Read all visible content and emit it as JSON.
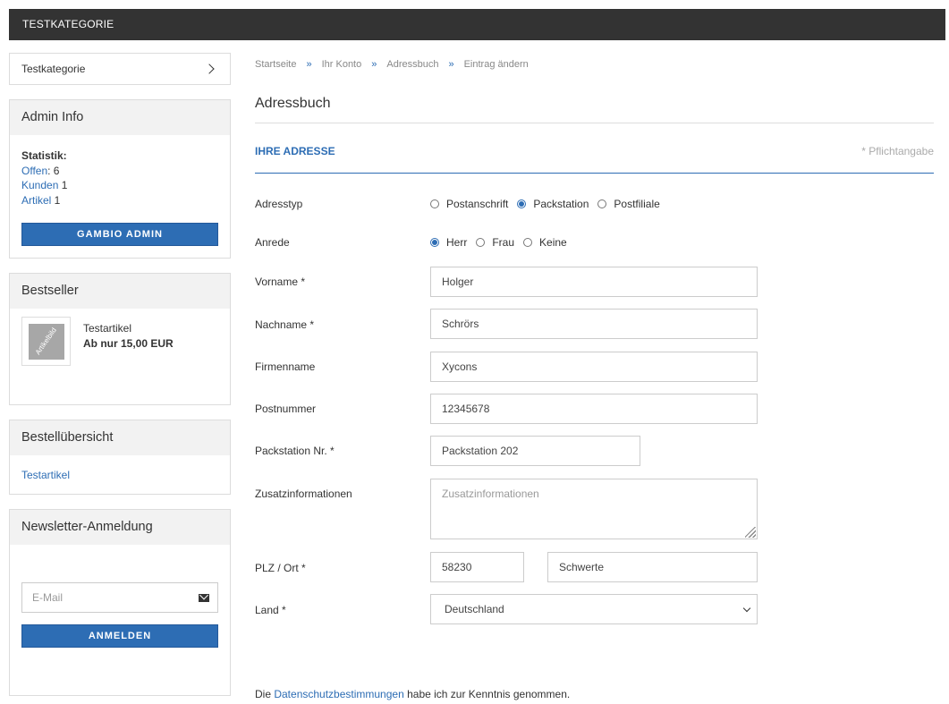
{
  "topbar": {
    "title": "TESTKATEGORIE"
  },
  "sidebar": {
    "category": {
      "label": "Testkategorie"
    },
    "admin": {
      "title": "Admin Info",
      "stat_title": "Statistik:",
      "offen_label": "Offen",
      "offen_value": ": 6",
      "kunden_label": "Kunden",
      "kunden_value": " 1",
      "artikel_label": "Artikel",
      "artikel_value": " 1",
      "button": "GAMBIO ADMIN"
    },
    "bestseller": {
      "title": "Bestseller",
      "thumb_text": "Artikelbild",
      "product_name": "Testartikel",
      "price": "Ab nur 15,00 EUR"
    },
    "order": {
      "title": "Bestellübersicht",
      "item": "Testartikel"
    },
    "newsletter": {
      "title": "Newsletter-Anmeldung",
      "placeholder": "E-Mail",
      "button": "ANMELDEN"
    }
  },
  "breadcrumb": {
    "sep": "»",
    "items": [
      "Startseite",
      "Ihr Konto",
      "Adressbuch",
      "Eintrag ändern"
    ]
  },
  "page": {
    "title": "Adressbuch",
    "section_title": "IHRE ADRESSE",
    "required_note": "* Pflichtangabe"
  },
  "form": {
    "adresstyp": {
      "label": "Adresstyp",
      "options": [
        "Postanschrift",
        "Packstation",
        "Postfiliale"
      ],
      "selected": "Packstation"
    },
    "anrede": {
      "label": "Anrede",
      "options": [
        "Herr",
        "Frau",
        "Keine"
      ],
      "selected": "Herr"
    },
    "vorname": {
      "label": "Vorname *",
      "value": "Holger"
    },
    "nachname": {
      "label": "Nachname *",
      "value": "Schrörs"
    },
    "firmenname": {
      "label": "Firmenname",
      "value": "Xycons"
    },
    "postnummer": {
      "label": "Postnummer",
      "value": "12345678"
    },
    "packstation": {
      "label": "Packstation Nr. *",
      "value": "Packstation 202"
    },
    "zusatz": {
      "label": "Zusatzinformationen",
      "placeholder": "Zusatzinformationen"
    },
    "plz_ort": {
      "label": "PLZ / Ort *",
      "plz": "58230",
      "ort": "Schwerte"
    },
    "land": {
      "label": "Land *",
      "value": "Deutschland"
    }
  },
  "privacy": {
    "before": "Die ",
    "link": "Datenschutzbestimmungen",
    "after": " habe ich zur Kenntnis genommen."
  },
  "colors": {
    "accent": "#2d6db4",
    "topbar": "#333333",
    "box_head": "#f2f2f2"
  }
}
